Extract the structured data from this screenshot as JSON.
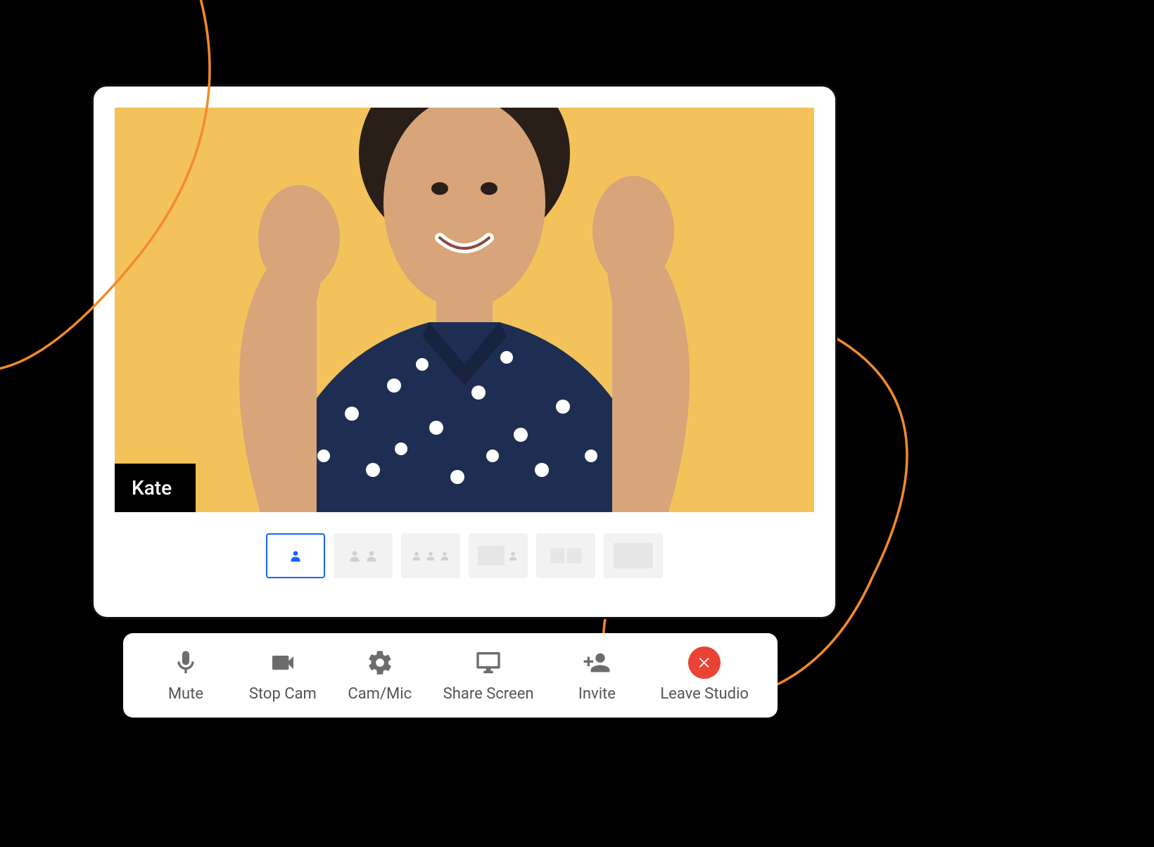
{
  "participant": {
    "name": "Kate"
  },
  "layout": {
    "active_index": 0,
    "options_count": 6
  },
  "toolbar": {
    "mute_label": "Mute",
    "stopcam_label": "Stop Cam",
    "cammic_label": "Cam/Mic",
    "share_label": "Share Screen",
    "invite_label": "Invite",
    "leave_label": "Leave Studio"
  },
  "colors": {
    "video_bg": "#f4c25a",
    "accent": "#1863ff",
    "leave": "#ea4335",
    "curve": "#f38a2e"
  }
}
